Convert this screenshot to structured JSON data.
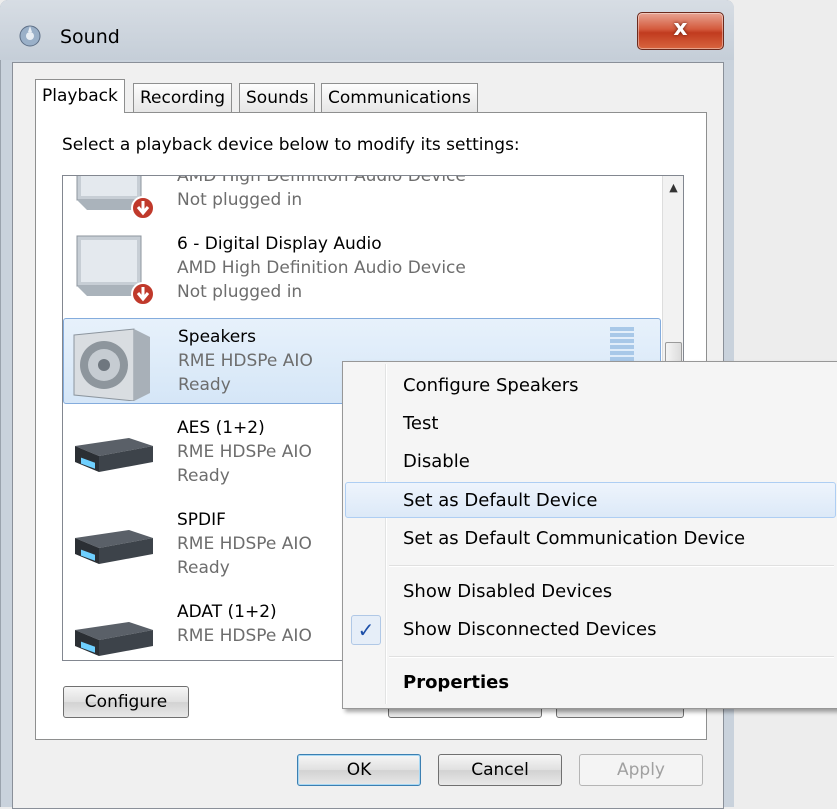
{
  "window": {
    "title": "Sound",
    "close_label": "x"
  },
  "tabs": [
    {
      "label": "Playback"
    },
    {
      "label": "Recording"
    },
    {
      "label": "Sounds"
    },
    {
      "label": "Communications"
    }
  ],
  "panel": {
    "instruction": "Select a playback device below to modify its settings:"
  },
  "devices": [
    {
      "name": "",
      "driver": "AMD High Definition Audio Device",
      "status": "Not plugged in",
      "icon": "monitor-unplugged-icon"
    },
    {
      "name": "6 - Digital Display Audio",
      "driver": "AMD High Definition Audio Device",
      "status": "Not plugged in",
      "icon": "monitor-unplugged-icon"
    },
    {
      "name": "Speakers",
      "driver": "RME HDSPe AIO",
      "status": "Ready",
      "icon": "speaker-icon"
    },
    {
      "name": "AES (1+2)",
      "driver": "RME HDSPe AIO",
      "status": "Ready",
      "icon": "audio-interface-icon"
    },
    {
      "name": "SPDIF",
      "driver": "RME HDSPe AIO",
      "status": "Ready",
      "icon": "audio-interface-icon"
    },
    {
      "name": "ADAT (1+2)",
      "driver": "RME HDSPe AIO",
      "status": "",
      "icon": "audio-interface-icon"
    }
  ],
  "buttons": {
    "configure": "Configure",
    "ok": "OK",
    "cancel": "Cancel",
    "apply": "Apply"
  },
  "context_menu": {
    "items": [
      {
        "label": "Configure Speakers"
      },
      {
        "label": "Test"
      },
      {
        "label": "Disable"
      },
      {
        "label": "Set as Default Device"
      },
      {
        "label": "Set as Default Communication Device"
      },
      {
        "label": "Show Disabled Devices"
      },
      {
        "label": "Show Disconnected Devices",
        "checked": true
      },
      {
        "label": "Properties"
      }
    ],
    "check_glyph": "✓"
  },
  "colors": {
    "selection": "#d5e6f7",
    "accent": "#1c4fa8",
    "close": "#c13b1f"
  }
}
